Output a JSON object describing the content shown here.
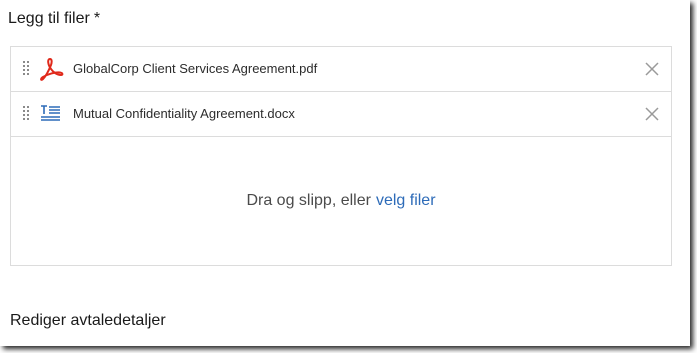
{
  "upload": {
    "title": "Legg til filer",
    "required_marker": "*",
    "files": [
      {
        "name": "GlobalCorp Client Services Agreement.pdf",
        "icon": "pdf-icon"
      },
      {
        "name": "Mutual Confidentiality Agreement.docx",
        "icon": "text-document-icon"
      }
    ],
    "drop_text": "Dra og slipp, eller",
    "browse_link": "velg filer"
  },
  "details": {
    "title": "Rediger avtaledetaljer"
  },
  "colors": {
    "link": "#2d6bb8",
    "pdf_icon": "#e0291b",
    "doc_icon": "#2d6bb8",
    "border": "#dcdcdc"
  }
}
